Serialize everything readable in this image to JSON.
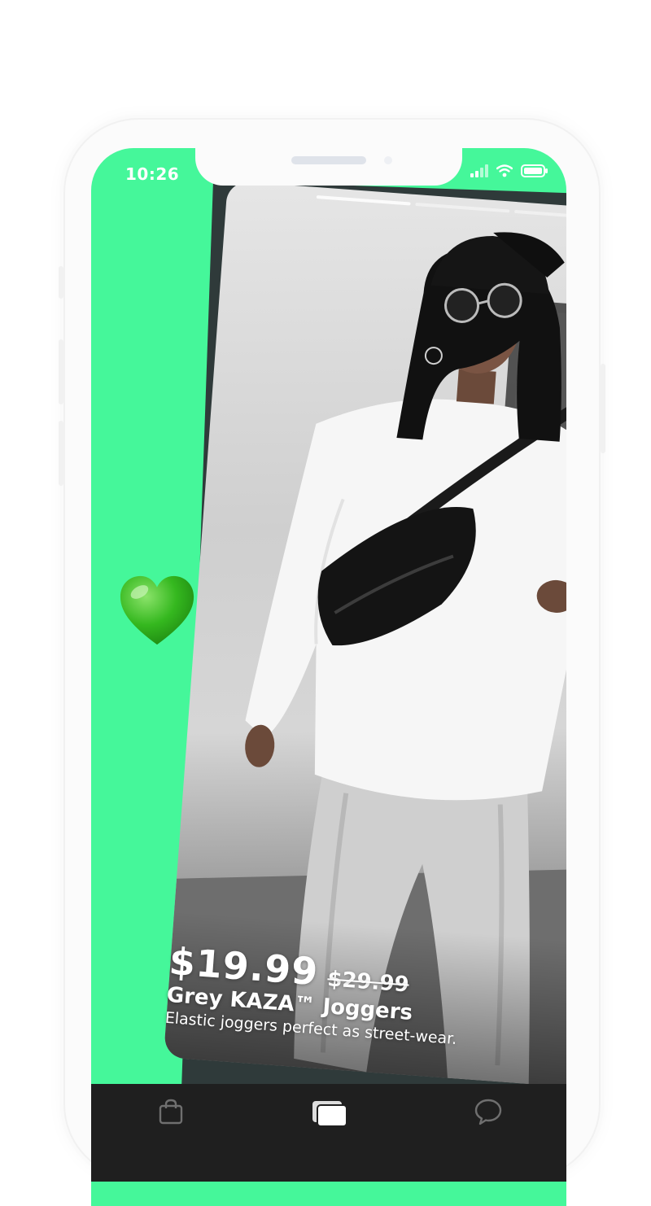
{
  "status_bar": {
    "time": "10:26"
  },
  "product": {
    "price": "$19.99",
    "old_price": "$29.99",
    "name": "Grey KAZA™ Joggers",
    "description": "Elastic joggers perfect as street-wear."
  },
  "swipe_feedback": {
    "reaction_icon": "green-heart-icon"
  },
  "tabs": [
    {
      "icon": "shopping-bag-icon",
      "active": false
    },
    {
      "icon": "cards-icon",
      "active": true
    },
    {
      "icon": "chat-bubble-icon",
      "active": false
    }
  ],
  "colors": {
    "accent_green": "#45f79a",
    "tab_bar": "#1f1f1f",
    "text_on_photo": "#ffffff"
  }
}
